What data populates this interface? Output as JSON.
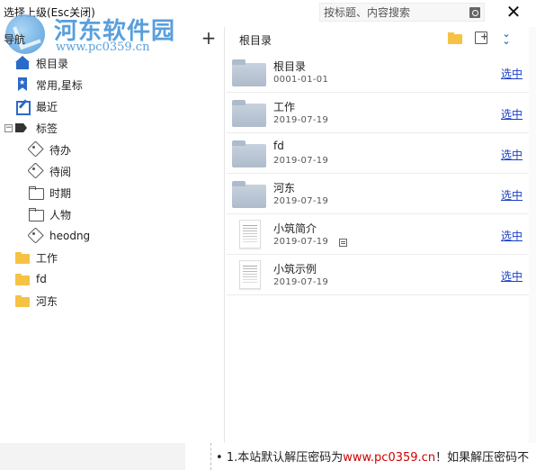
{
  "titlebar": {
    "title": "选择上级(Esc关闭)",
    "search_placeholder": "按标题、内容搜索",
    "close_label": "✕"
  },
  "watermark": {
    "title": "河东软件园",
    "url": "www.pc0359.cn"
  },
  "left_pane": {
    "header_label": "导航",
    "add_label": "+",
    "tree": [
      {
        "label": "根目录",
        "icon": "home-icon"
      },
      {
        "label": "常用,星标",
        "icon": "star-bookmark-icon"
      },
      {
        "label": "最近",
        "icon": "edit-icon"
      },
      {
        "label": "标签",
        "icon": "tag-icon",
        "expander": "−"
      },
      {
        "label": "待办",
        "icon": "tag-outline-icon"
      },
      {
        "label": "待阅",
        "icon": "tag-outline-icon"
      },
      {
        "label": "时期",
        "icon": "folder-outline-icon"
      },
      {
        "label": "人物",
        "icon": "folder-outline-icon"
      },
      {
        "label": "heodng",
        "icon": "tag-outline-icon"
      },
      {
        "label": "工作",
        "icon": "folder-icon"
      },
      {
        "label": "fd",
        "icon": "folder-icon"
      },
      {
        "label": "河东",
        "icon": "folder-icon"
      }
    ]
  },
  "right_pane": {
    "title": "根目录",
    "items": [
      {
        "name": "根目录",
        "date": "0001-01-01",
        "type": "folder",
        "action": "选中"
      },
      {
        "name": "工作",
        "date": "2019-07-19",
        "type": "folder",
        "action": "选中"
      },
      {
        "name": "fd",
        "date": "2019-07-19",
        "type": "folder",
        "action": "选中"
      },
      {
        "name": "河东",
        "date": "2019-07-19",
        "type": "folder",
        "action": "选中"
      },
      {
        "name": "小筑简介",
        "date": "2019-07-19",
        "type": "document",
        "action": "选中"
      },
      {
        "name": "小筑示例",
        "date": "2019-07-19",
        "type": "document",
        "action": "选中"
      }
    ]
  },
  "bottom": {
    "bullet": "•",
    "note_prefix": "1.本站默认解压密码为",
    "note_url": "www.pc0359.cn",
    "note_suffix": "！如果解压密码不"
  },
  "colors": {
    "accent_blue": "#2a6ac8",
    "link_blue": "#1a3fc7",
    "folder_yellow": "#f6c244",
    "folder_gray": "#aebbcb",
    "watermark_blue": "#3b8fd8",
    "note_red": "#d10000"
  }
}
